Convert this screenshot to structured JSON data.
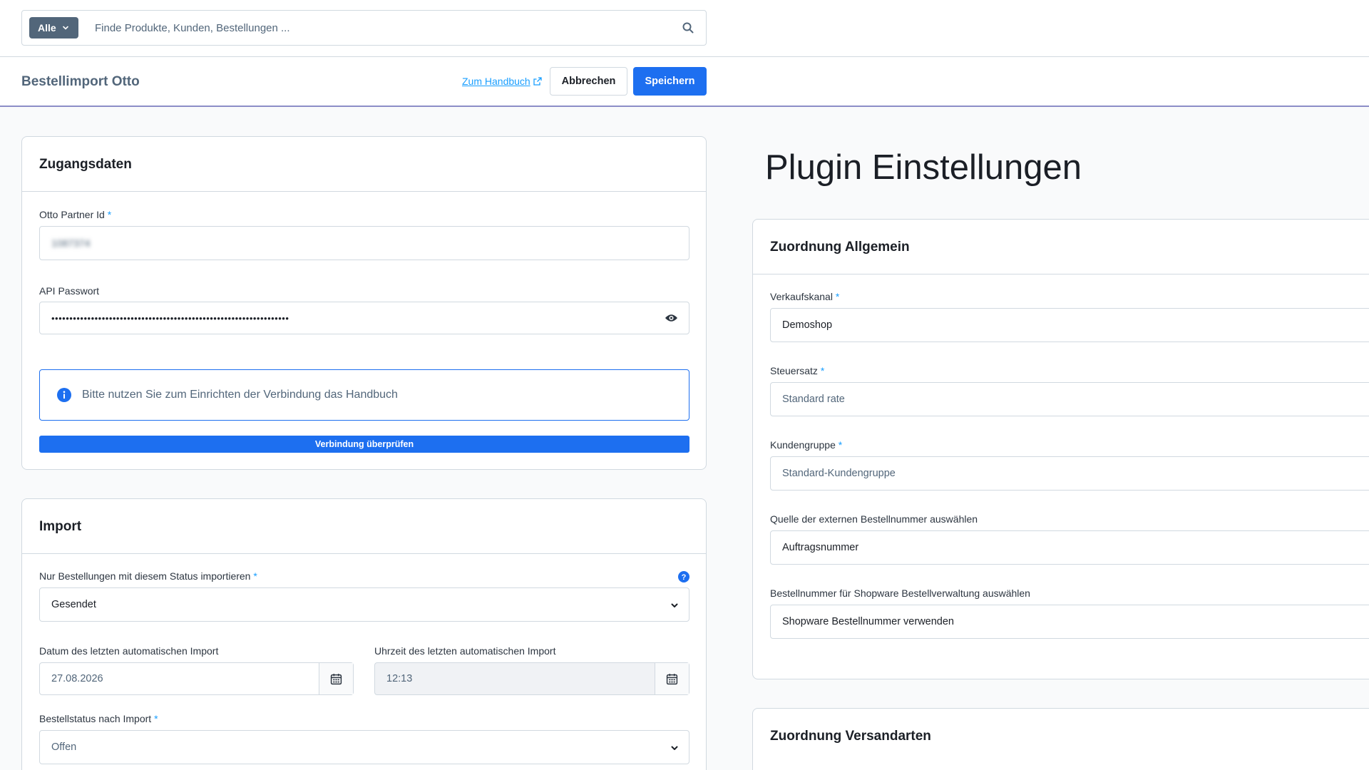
{
  "search": {
    "type_label": "Alle",
    "placeholder": "Finde Produkte, Kunden, Bestellungen ..."
  },
  "smartbar": {
    "title": "Bestellimport Otto",
    "manual_link": "Zum Handbuch",
    "cancel_label": "Abbrechen",
    "save_label": "Speichern"
  },
  "access": {
    "title": "Zugangsdaten",
    "partner_id_label": "Otto Partner Id",
    "partner_id_value": "1087374",
    "api_password_label": "API Passwort",
    "api_password_value": "••••••••••••••••••••••••••••••••••••••••••••••••••••••••••••••••••",
    "info_text": "Bitte nutzen Sie zum Einrichten der Verbindung das Handbuch",
    "verify_button": "Verbindung überprüfen"
  },
  "import": {
    "title": "Import",
    "status_label": "Nur Bestellungen mit diesem Status importieren",
    "status_value": "Gesendet",
    "last_date_label": "Datum des letzten automatischen Import",
    "last_date_value": "27.08.2026",
    "last_time_label": "Uhrzeit des letzten automatischen Import",
    "last_time_value": "12:13",
    "order_status_label": "Bestellstatus nach Import",
    "order_status_value": "Offen"
  },
  "plugin_heading": "Plugin Einstellungen",
  "general": {
    "title": "Zuordnung Allgemein",
    "sales_channel_label": "Verkaufskanal",
    "sales_channel_value": "Demoshop",
    "tax_label": "Steuersatz",
    "tax_value": "Standard rate",
    "customer_group_label": "Kundengruppe",
    "customer_group_value": "Standard-Kundengruppe",
    "external_source_label": "Quelle der externen Bestellnummer auswählen",
    "external_source_value": "Auftragsnummer",
    "order_number_label": "Bestellnummer für Shopware Bestellverwaltung auswählen",
    "order_number_value": "Shopware Bestellnummer verwenden"
  },
  "shipping": {
    "title": "Zuordnung Versandarten"
  },
  "required_marker": "*",
  "colors": {
    "primary": "#1d6ff0",
    "link": "#189eff",
    "border": "#d1d9e0",
    "smartbar_border": "#8c8dc7"
  }
}
